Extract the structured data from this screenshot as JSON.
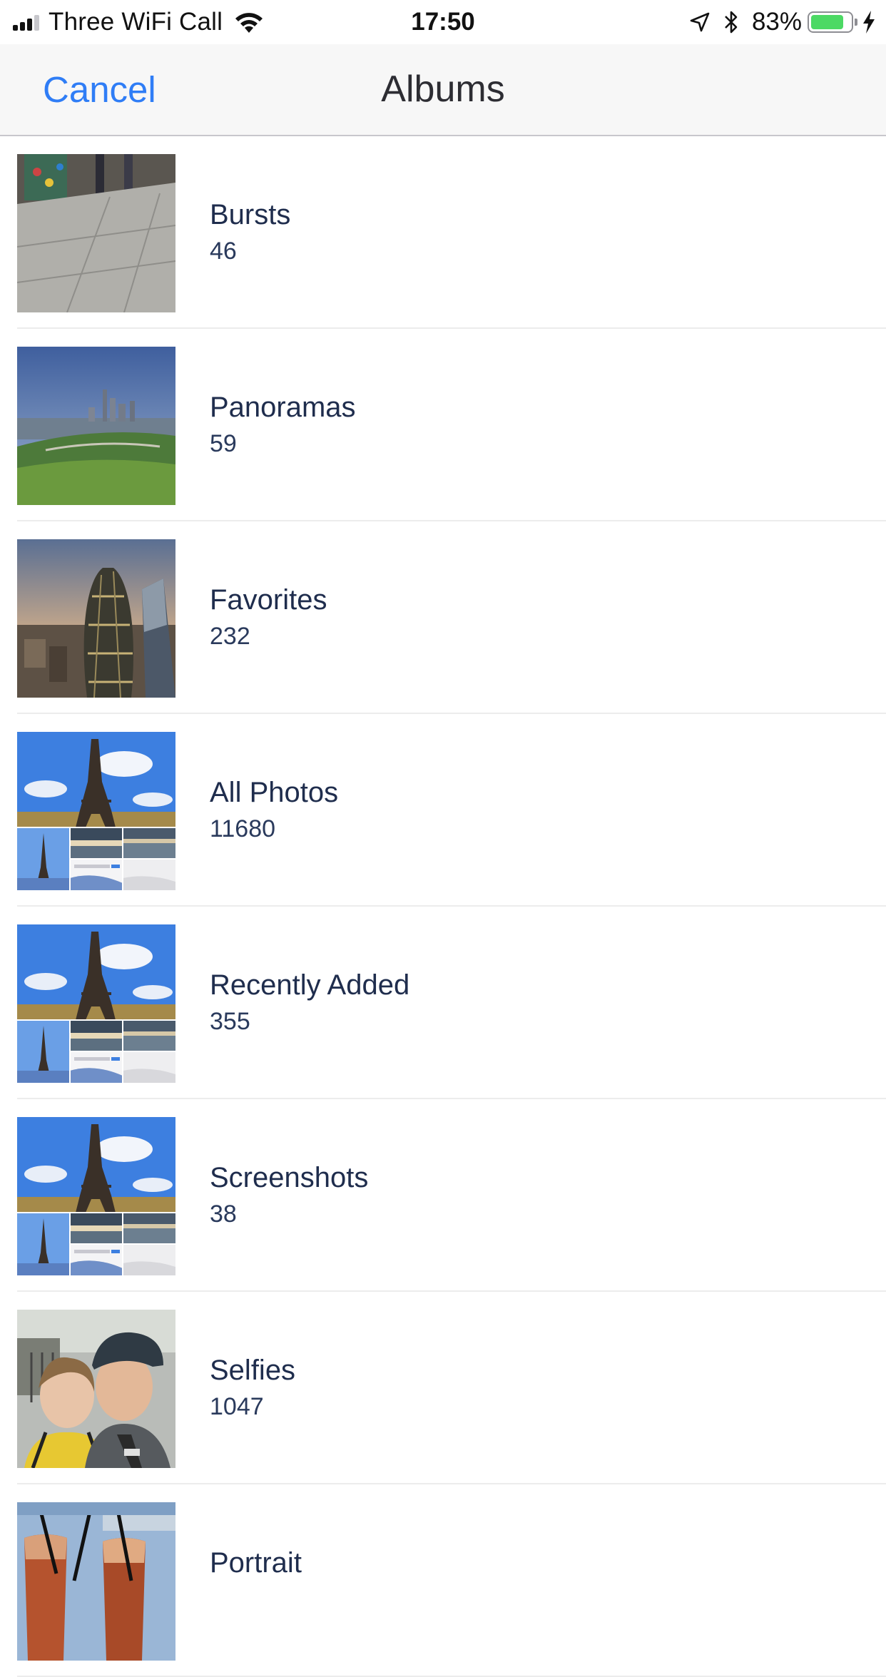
{
  "status_bar": {
    "carrier": "Three WiFi Call",
    "time": "17:50",
    "battery_percent": "83%",
    "battery_level": 0.83,
    "icons": [
      "signal-icon",
      "wifi-icon",
      "location-icon",
      "bluetooth-icon",
      "battery-icon",
      "charging-icon"
    ]
  },
  "nav": {
    "cancel_label": "Cancel",
    "title": "Albums"
  },
  "colors": {
    "accent": "#2f7df6",
    "text": "#1f2d4d",
    "battery": "#4cd964"
  },
  "albums": [
    {
      "name": "Bursts",
      "count": "46",
      "thumb": "street-pavement"
    },
    {
      "name": "Panoramas",
      "count": "59",
      "thumb": "city-skyline-park"
    },
    {
      "name": "Favorites",
      "count": "232",
      "thumb": "gherkin-tower"
    },
    {
      "name": "All Photos",
      "count": "11680",
      "thumb": "eiffel-collage"
    },
    {
      "name": "Recently Added",
      "count": "355",
      "thumb": "eiffel-collage"
    },
    {
      "name": "Screenshots",
      "count": "38",
      "thumb": "eiffel-collage"
    },
    {
      "name": "Selfies",
      "count": "1047",
      "thumb": "couple-selfie"
    },
    {
      "name": "Portrait",
      "count": "",
      "thumb": "drinks"
    }
  ]
}
